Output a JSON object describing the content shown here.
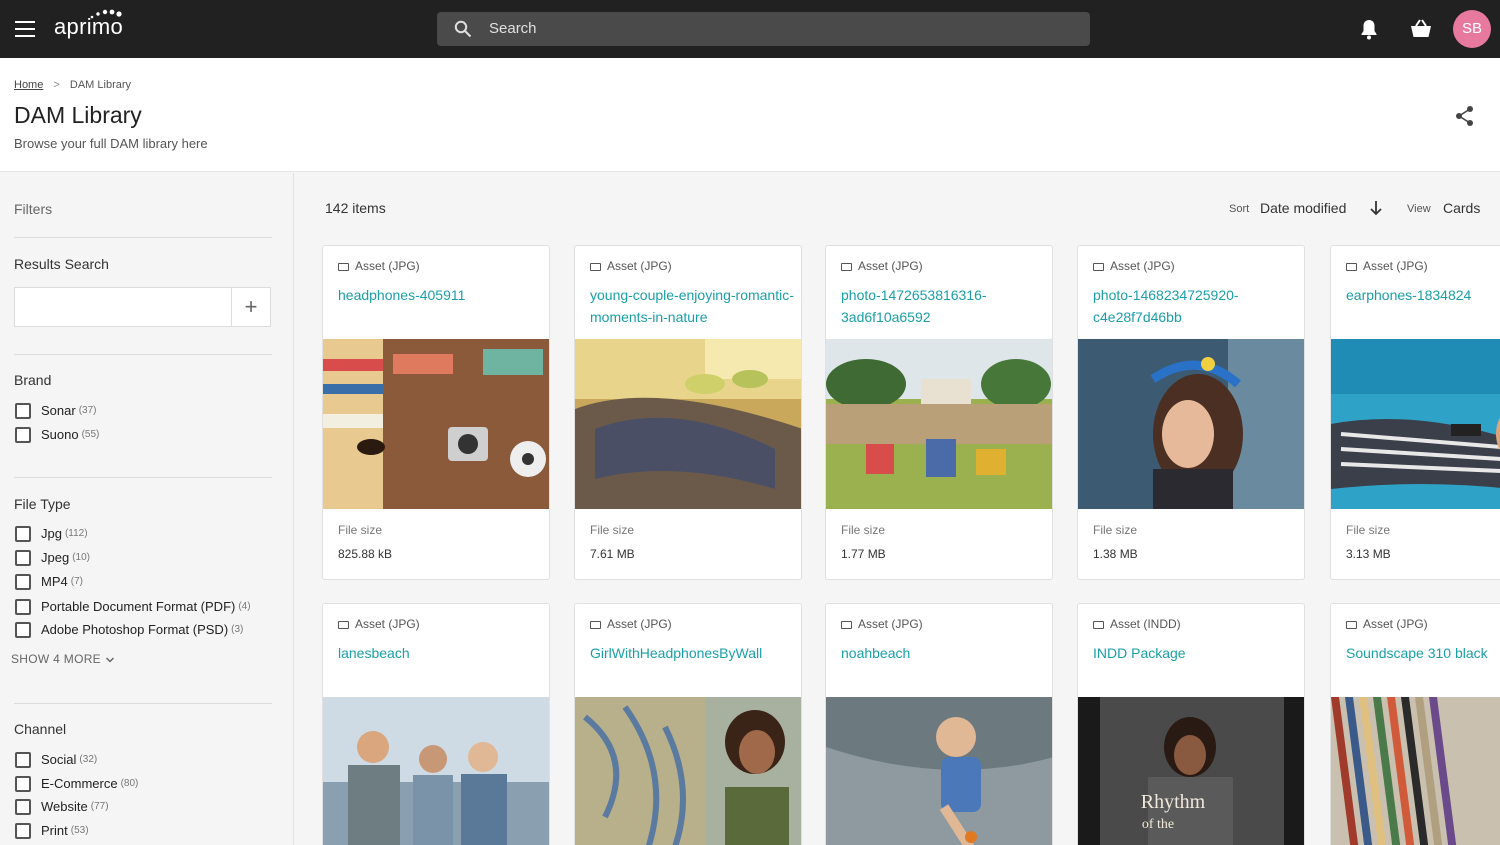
{
  "app": {
    "logo_text": "aprimo",
    "user_initials": "SB"
  },
  "search": {
    "placeholder": "Search"
  },
  "breadcrumb": {
    "home": "Home",
    "separator": ">",
    "current": "DAM Library"
  },
  "page": {
    "title": "DAM Library",
    "subtitle": "Browse your full DAM library here"
  },
  "sidebar": {
    "filters_label": "Filters",
    "results_search": {
      "label": "Results Search",
      "value": "",
      "add_glyph": "+"
    },
    "brand": {
      "title": "Brand",
      "items": [
        {
          "label": "Sonar",
          "count": "(37)"
        },
        {
          "label": "Suono",
          "count": "(55)"
        }
      ]
    },
    "file_type": {
      "title": "File Type",
      "items": [
        {
          "label": "Jpg",
          "count": "(112)"
        },
        {
          "label": "Jpeg",
          "count": "(10)"
        },
        {
          "label": "MP4",
          "count": "(7)"
        },
        {
          "label": "Portable Document Format (PDF)",
          "count": "(4)"
        },
        {
          "label": "Adobe Photoshop Format (PSD)",
          "count": "(3)"
        }
      ],
      "show_more": "SHOW 4 MORE"
    },
    "channel": {
      "title": "Channel",
      "items": [
        {
          "label": "Social",
          "count": "(32)"
        },
        {
          "label": "E-Commerce",
          "count": "(80)"
        },
        {
          "label": "Website",
          "count": "(77)"
        },
        {
          "label": "Print",
          "count": "(53)"
        }
      ]
    }
  },
  "toolbar": {
    "items_count": "142 items",
    "sort_label": "Sort",
    "sort_value": "Date modified",
    "view_label": "View",
    "view_value": "Cards"
  },
  "cards": [
    {
      "type": "Asset (JPG)",
      "title": "headphones-405911",
      "file_size_label": "File size",
      "file_size": "825.88 kB"
    },
    {
      "type": "Asset (JPG)",
      "title": "young-couple-enjoying-romantic-moments-in-nature",
      "file_size_label": "File size",
      "file_size": "7.61 MB"
    },
    {
      "type": "Asset (JPG)",
      "title": "photo-1472653816316-3ad6f10a6592",
      "file_size_label": "File size",
      "file_size": "1.77 MB"
    },
    {
      "type": "Asset (JPG)",
      "title": "photo-1468234725920-c4e28f7d46bb",
      "file_size_label": "File size",
      "file_size": "1.38 MB"
    },
    {
      "type": "Asset (JPG)",
      "title": "earphones-1834824",
      "file_size_label": "File size",
      "file_size": "3.13 MB"
    },
    {
      "type": "Asset (JPG)",
      "title": "lanesbeach"
    },
    {
      "type": "Asset (JPG)",
      "title": "GirlWithHeadphonesByWall"
    },
    {
      "type": "Asset (JPG)",
      "title": "noahbeach"
    },
    {
      "type": "Asset (INDD)",
      "title": "INDD Package",
      "thumb_text_1": "Rhythm",
      "thumb_text_2": "of the"
    },
    {
      "type": "Asset (JPG)",
      "title": "Soundscape 310 black"
    }
  ],
  "colors": {
    "topbar": "#212121",
    "accent_link": "#1a9fa8",
    "avatar": "#e7799f"
  }
}
